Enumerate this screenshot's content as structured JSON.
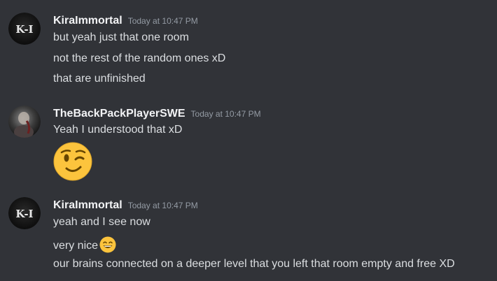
{
  "messages": [
    {
      "author": "KiraImmortal",
      "avatar_text": "K-I",
      "timestamp": "Today at 10:47 PM",
      "lines": [
        "but yeah just that one room",
        "not the rest of the random ones xD",
        "that are unfinished"
      ]
    },
    {
      "author": "TheBackPackPlayerSWE",
      "timestamp": "Today at 10:47 PM",
      "lines": [
        "Yeah I understood that xD"
      ],
      "emoji": "winking-face"
    },
    {
      "author": "KiraImmortal",
      "avatar_text": "K-I",
      "timestamp": "Today at 10:47 PM",
      "lines": [
        "yeah and I see now",
        "very nice",
        "our brains connected on a deeper level that you left that room empty and free XD"
      ],
      "inline_emoji": "grinning-face-with-smiling-eyes"
    }
  ],
  "colors": {
    "background": "#313338",
    "username": "#f2f3f5",
    "timestamp": "#949ba4",
    "text": "#dbdee1",
    "emoji_yellow": "#fcc43d"
  }
}
